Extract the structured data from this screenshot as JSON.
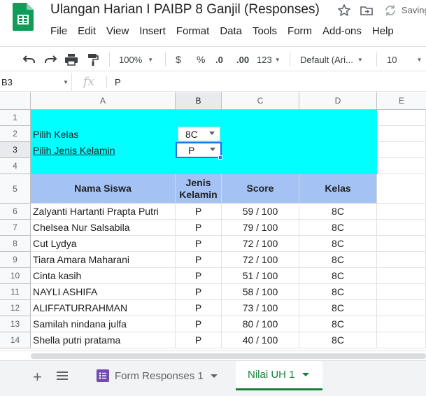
{
  "app": {
    "doc_title": "Ulangan Harian I PAIBP 8 Ganjil (Responses)",
    "status": "Saving",
    "menu": [
      "File",
      "Edit",
      "View",
      "Insert",
      "Format",
      "Data",
      "Tools",
      "Form",
      "Add-ons",
      "Help"
    ]
  },
  "toolbar": {
    "zoom": "100%",
    "currency": "$",
    "percent": "%",
    "decrease_decimal": ".0",
    "increase_decimal": ".00",
    "more_formats": "123",
    "font": "Default (Ari...",
    "font_size": "10"
  },
  "formula_bar": {
    "name_box": "B3",
    "fx": "fx",
    "value": "P"
  },
  "grid": {
    "columns": [
      "A",
      "B",
      "C",
      "D",
      "E"
    ],
    "rows": [
      "1",
      "2",
      "3",
      "4",
      "5",
      "6",
      "7",
      "8",
      "9",
      "10",
      "11",
      "12",
      "13",
      "14"
    ],
    "filters": {
      "kelas_label": "Pilih Kelas",
      "kelas_value": "8C",
      "gender_label": "Pilih Jenis Kelamin",
      "gender_value": "P"
    },
    "headers": {
      "name": "Nama Siswa",
      "gender_line1": "Jenis",
      "gender_line2": "Kelamin",
      "score": "Score",
      "class": "Kelas"
    },
    "students": [
      {
        "name": "Zalyanti Hartanti Prapta Putri",
        "gender": "P",
        "score": "59 / 100",
        "class": "8C"
      },
      {
        "name": "Chelsea Nur Salsabila",
        "gender": "P",
        "score": "79 / 100",
        "class": "8C"
      },
      {
        "name": "Cut Lydya",
        "gender": "P",
        "score": "72 / 100",
        "class": "8C"
      },
      {
        "name": "Tiara Amara Maharani",
        "gender": "P",
        "score": "72 / 100",
        "class": "8C"
      },
      {
        "name": "Cinta kasih",
        "gender": "P",
        "score": "51 / 100",
        "class": "8C"
      },
      {
        "name": "NAYLI ASHIFA",
        "gender": "P",
        "score": "58 / 100",
        "class": "8C"
      },
      {
        "name": "ALIFFATURRAHMAN",
        "gender": "P",
        "score": "73 / 100",
        "class": "8C"
      },
      {
        "name": "Samilah nindana julfa",
        "gender": "P",
        "score": "80 / 100",
        "class": "8C"
      },
      {
        "name": "Shella putri pratama",
        "gender": "P",
        "score": "40 / 100",
        "class": "8C"
      }
    ]
  },
  "sheet_tabs": [
    {
      "label": "Form Responses 1",
      "active": false
    },
    {
      "label": "Nilai UH 1",
      "active": true
    }
  ],
  "colors": {
    "filter_bg": "#00ffff",
    "header_bg": "#a4c2f4",
    "selection": "#1a73e8",
    "active_tab": "#188038",
    "sheets_green": "#0f9d58"
  }
}
